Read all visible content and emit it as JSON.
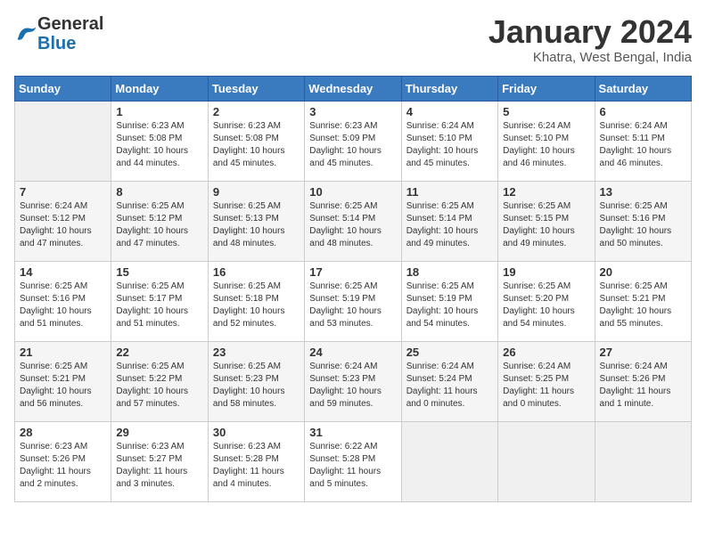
{
  "logo": {
    "general": "General",
    "blue": "Blue"
  },
  "header": {
    "title": "January 2024",
    "location": "Khatra, West Bengal, India"
  },
  "days_of_week": [
    "Sunday",
    "Monday",
    "Tuesday",
    "Wednesday",
    "Thursday",
    "Friday",
    "Saturday"
  ],
  "weeks": [
    [
      {
        "num": "",
        "info": ""
      },
      {
        "num": "1",
        "info": "Sunrise: 6:23 AM\nSunset: 5:08 PM\nDaylight: 10 hours\nand 44 minutes."
      },
      {
        "num": "2",
        "info": "Sunrise: 6:23 AM\nSunset: 5:08 PM\nDaylight: 10 hours\nand 45 minutes."
      },
      {
        "num": "3",
        "info": "Sunrise: 6:23 AM\nSunset: 5:09 PM\nDaylight: 10 hours\nand 45 minutes."
      },
      {
        "num": "4",
        "info": "Sunrise: 6:24 AM\nSunset: 5:10 PM\nDaylight: 10 hours\nand 45 minutes."
      },
      {
        "num": "5",
        "info": "Sunrise: 6:24 AM\nSunset: 5:10 PM\nDaylight: 10 hours\nand 46 minutes."
      },
      {
        "num": "6",
        "info": "Sunrise: 6:24 AM\nSunset: 5:11 PM\nDaylight: 10 hours\nand 46 minutes."
      }
    ],
    [
      {
        "num": "7",
        "info": "Sunrise: 6:24 AM\nSunset: 5:12 PM\nDaylight: 10 hours\nand 47 minutes."
      },
      {
        "num": "8",
        "info": "Sunrise: 6:25 AM\nSunset: 5:12 PM\nDaylight: 10 hours\nand 47 minutes."
      },
      {
        "num": "9",
        "info": "Sunrise: 6:25 AM\nSunset: 5:13 PM\nDaylight: 10 hours\nand 48 minutes."
      },
      {
        "num": "10",
        "info": "Sunrise: 6:25 AM\nSunset: 5:14 PM\nDaylight: 10 hours\nand 48 minutes."
      },
      {
        "num": "11",
        "info": "Sunrise: 6:25 AM\nSunset: 5:14 PM\nDaylight: 10 hours\nand 49 minutes."
      },
      {
        "num": "12",
        "info": "Sunrise: 6:25 AM\nSunset: 5:15 PM\nDaylight: 10 hours\nand 49 minutes."
      },
      {
        "num": "13",
        "info": "Sunrise: 6:25 AM\nSunset: 5:16 PM\nDaylight: 10 hours\nand 50 minutes."
      }
    ],
    [
      {
        "num": "14",
        "info": "Sunrise: 6:25 AM\nSunset: 5:16 PM\nDaylight: 10 hours\nand 51 minutes."
      },
      {
        "num": "15",
        "info": "Sunrise: 6:25 AM\nSunset: 5:17 PM\nDaylight: 10 hours\nand 51 minutes."
      },
      {
        "num": "16",
        "info": "Sunrise: 6:25 AM\nSunset: 5:18 PM\nDaylight: 10 hours\nand 52 minutes."
      },
      {
        "num": "17",
        "info": "Sunrise: 6:25 AM\nSunset: 5:19 PM\nDaylight: 10 hours\nand 53 minutes."
      },
      {
        "num": "18",
        "info": "Sunrise: 6:25 AM\nSunset: 5:19 PM\nDaylight: 10 hours\nand 54 minutes."
      },
      {
        "num": "19",
        "info": "Sunrise: 6:25 AM\nSunset: 5:20 PM\nDaylight: 10 hours\nand 54 minutes."
      },
      {
        "num": "20",
        "info": "Sunrise: 6:25 AM\nSunset: 5:21 PM\nDaylight: 10 hours\nand 55 minutes."
      }
    ],
    [
      {
        "num": "21",
        "info": "Sunrise: 6:25 AM\nSunset: 5:21 PM\nDaylight: 10 hours\nand 56 minutes."
      },
      {
        "num": "22",
        "info": "Sunrise: 6:25 AM\nSunset: 5:22 PM\nDaylight: 10 hours\nand 57 minutes."
      },
      {
        "num": "23",
        "info": "Sunrise: 6:25 AM\nSunset: 5:23 PM\nDaylight: 10 hours\nand 58 minutes."
      },
      {
        "num": "24",
        "info": "Sunrise: 6:24 AM\nSunset: 5:23 PM\nDaylight: 10 hours\nand 59 minutes."
      },
      {
        "num": "25",
        "info": "Sunrise: 6:24 AM\nSunset: 5:24 PM\nDaylight: 11 hours\nand 0 minutes."
      },
      {
        "num": "26",
        "info": "Sunrise: 6:24 AM\nSunset: 5:25 PM\nDaylight: 11 hours\nand 0 minutes."
      },
      {
        "num": "27",
        "info": "Sunrise: 6:24 AM\nSunset: 5:26 PM\nDaylight: 11 hours\nand 1 minute."
      }
    ],
    [
      {
        "num": "28",
        "info": "Sunrise: 6:23 AM\nSunset: 5:26 PM\nDaylight: 11 hours\nand 2 minutes."
      },
      {
        "num": "29",
        "info": "Sunrise: 6:23 AM\nSunset: 5:27 PM\nDaylight: 11 hours\nand 3 minutes."
      },
      {
        "num": "30",
        "info": "Sunrise: 6:23 AM\nSunset: 5:28 PM\nDaylight: 11 hours\nand 4 minutes."
      },
      {
        "num": "31",
        "info": "Sunrise: 6:22 AM\nSunset: 5:28 PM\nDaylight: 11 hours\nand 5 minutes."
      },
      {
        "num": "",
        "info": ""
      },
      {
        "num": "",
        "info": ""
      },
      {
        "num": "",
        "info": ""
      }
    ]
  ]
}
